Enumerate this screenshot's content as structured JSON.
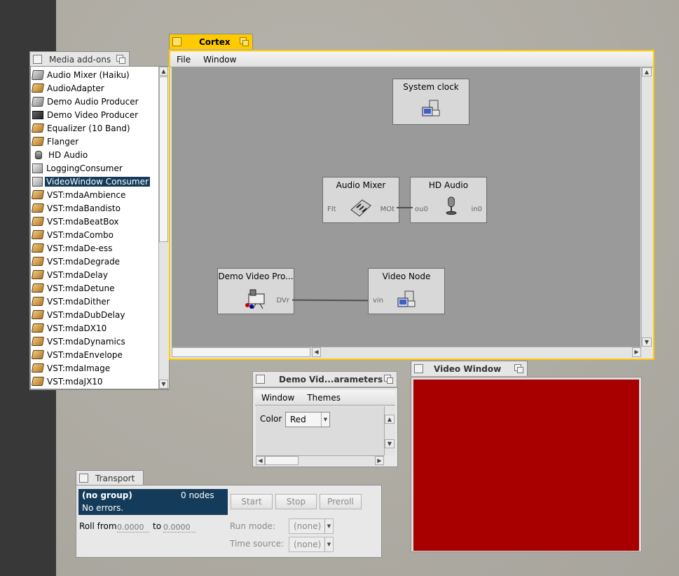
{
  "media_addons": {
    "title": "Media add-ons",
    "items": [
      {
        "label": "Audio Mixer (Haiku)",
        "icon": "mixer-icon"
      },
      {
        "label": "AudioAdapter",
        "icon": "effect-icon"
      },
      {
        "label": "Demo Audio Producer",
        "icon": "mixer-icon"
      },
      {
        "label": "Demo Video Producer",
        "icon": "camera-icon"
      },
      {
        "label": "Equalizer (10 Band)",
        "icon": "effect-icon"
      },
      {
        "label": "Flanger",
        "icon": "effect-icon"
      },
      {
        "label": "HD Audio",
        "icon": "microphone-icon"
      },
      {
        "label": "LoggingConsumer",
        "icon": "computer-icon"
      },
      {
        "label": "VideoWindow Consumer",
        "icon": "computer-icon",
        "selected": true
      },
      {
        "label": "VST:mdaAmbience",
        "icon": "effect-icon"
      },
      {
        "label": "VST:mdaBandisto",
        "icon": "effect-icon"
      },
      {
        "label": "VST:mdaBeatBox",
        "icon": "effect-icon"
      },
      {
        "label": "VST:mdaCombo",
        "icon": "effect-icon"
      },
      {
        "label": "VST:mdaDe-ess",
        "icon": "effect-icon"
      },
      {
        "label": "VST:mdaDegrade",
        "icon": "effect-icon"
      },
      {
        "label": "VST:mdaDelay",
        "icon": "effect-icon"
      },
      {
        "label": "VST:mdaDetune",
        "icon": "effect-icon"
      },
      {
        "label": "VST:mdaDither",
        "icon": "effect-icon"
      },
      {
        "label": "VST:mdaDubDelay",
        "icon": "effect-icon"
      },
      {
        "label": "VST:mdaDX10",
        "icon": "effect-icon"
      },
      {
        "label": "VST:mdaDynamics",
        "icon": "effect-icon"
      },
      {
        "label": "VST:mdaEnvelope",
        "icon": "effect-icon"
      },
      {
        "label": "VST:mdaImage",
        "icon": "effect-icon"
      },
      {
        "label": "VST:mdaJX10",
        "icon": "effect-icon"
      }
    ]
  },
  "cortex": {
    "title": "Cortex",
    "menu": [
      "File",
      "Window"
    ],
    "nodes": {
      "system_clock": {
        "title": "System clock"
      },
      "audio_mixer": {
        "title": "Audio Mixer",
        "in_port": "FIt",
        "out_port": "MOt"
      },
      "hd_audio": {
        "title": "HD Audio",
        "in_port": "ou0",
        "out_port": "in0"
      },
      "demo_video": {
        "title": "Demo Video Pro...",
        "out_port": "DVr"
      },
      "video_node": {
        "title": "Video Node",
        "in_port": "vin"
      }
    }
  },
  "params_window": {
    "title": "Demo Vid...arameters",
    "menu": [
      "Window",
      "Themes"
    ],
    "color_label": "Color",
    "color_value": "Red"
  },
  "video_window": {
    "title": "Video Window",
    "fill_color": "#a80000"
  },
  "transport": {
    "title": "Transport",
    "group_name": "(no group)",
    "node_count": "0 nodes",
    "status": "No errors.",
    "start": "Start",
    "stop": "Stop",
    "preroll": "Preroll",
    "roll_from_label": "Roll from",
    "roll_from": "0.0000",
    "to_label": "to",
    "roll_to": "0.0000",
    "run_mode_label": "Run mode:",
    "run_mode_value": "(none)",
    "time_source_label": "Time source:",
    "time_source_value": "(none)"
  }
}
